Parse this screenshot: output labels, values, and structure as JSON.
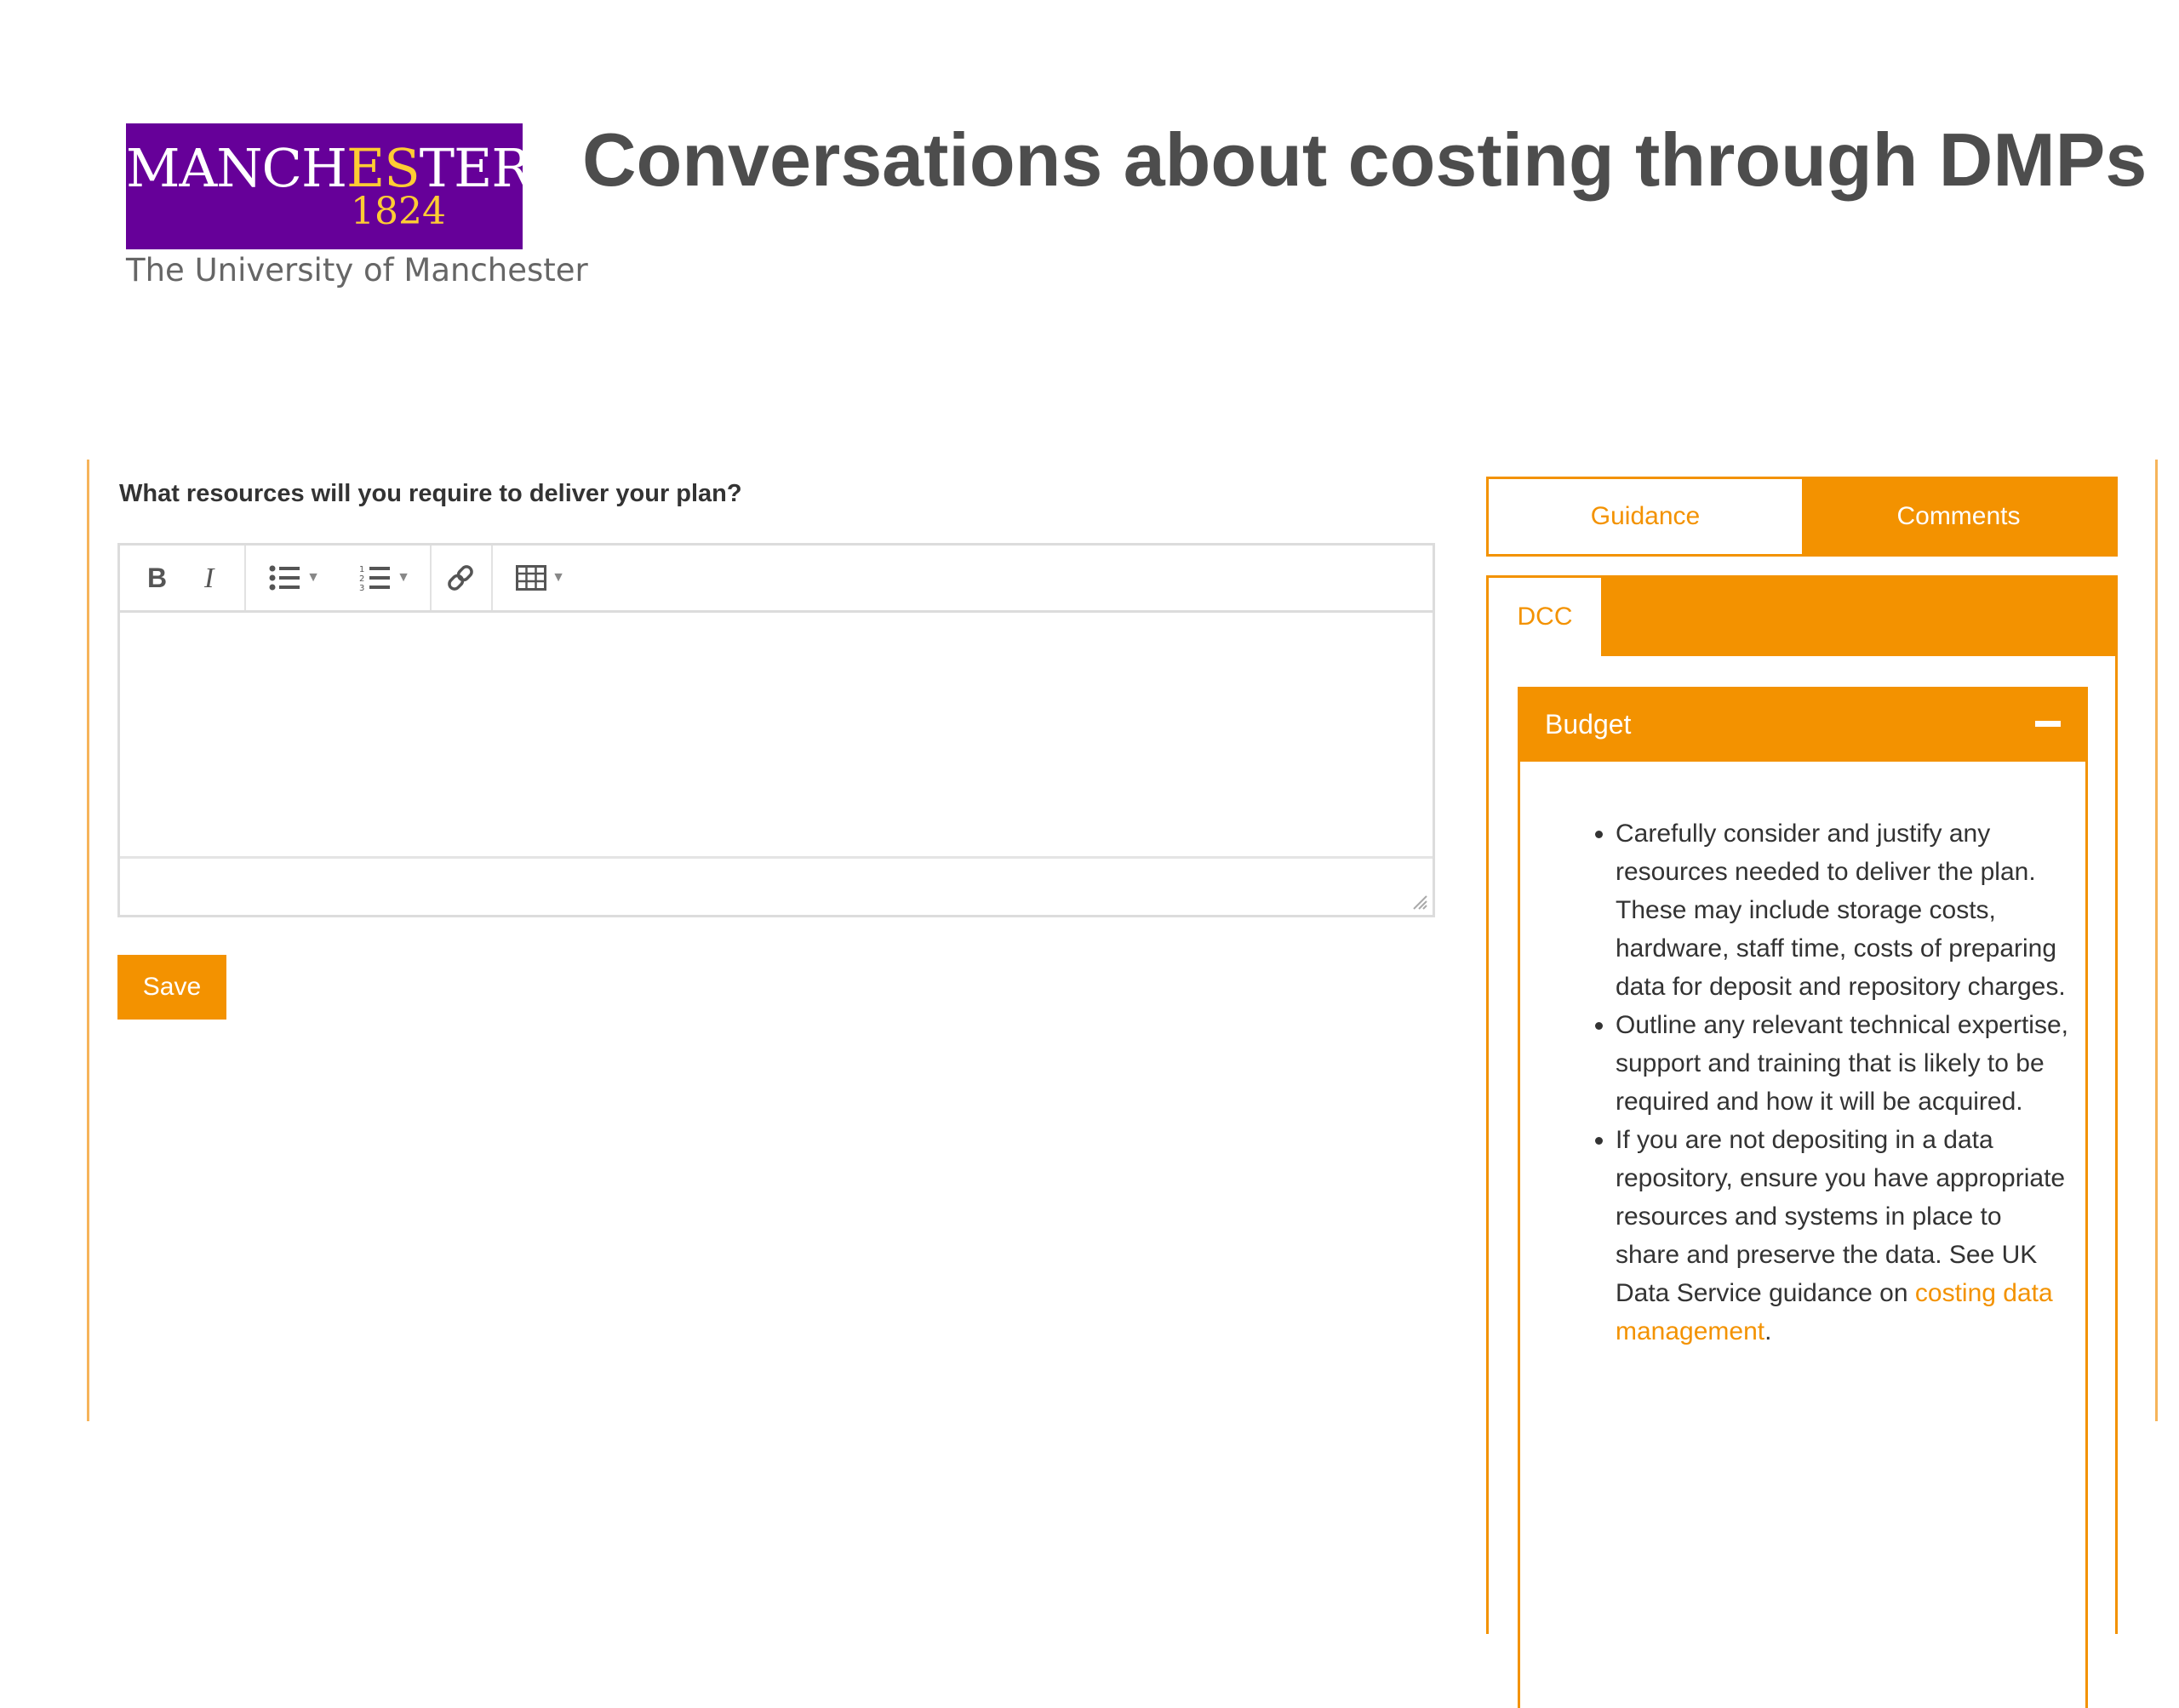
{
  "logo": {
    "word_part1": "MANCH",
    "word_part2": "ES",
    "word_part3": "T",
    "word_part4": "ER",
    "year": "1824",
    "subtitle": "The University of Manchester",
    "colors": {
      "background": "#660099",
      "accent": "#ffcc33"
    }
  },
  "slide_title": "Conversations about costing through DMPs",
  "question": "What resources will you require to deliver your plan?",
  "editor": {
    "toolbar": [
      {
        "name": "bold-icon"
      },
      {
        "name": "italic-icon"
      },
      {
        "name": "bullet-list-icon"
      },
      {
        "name": "numbered-list-icon"
      },
      {
        "name": "link-icon"
      },
      {
        "name": "table-icon"
      }
    ],
    "value": ""
  },
  "save_label": "Save",
  "tabs": {
    "guidance": "Guidance",
    "comments": "Comments"
  },
  "guidance": {
    "source_tab": "DCC",
    "section_title": "Budget",
    "bullets": [
      "Carefully consider and justify any resources needed to deliver the plan. These may include storage costs, hardware, staff time, costs of preparing data for deposit and repository charges.",
      "Outline any relevant technical expertise, support and training that is likely to be required and how it will be acquired."
    ],
    "bullet3_prefix": "If you are not depositing in a data repository, ensure you have appropriate resources and systems in place to share and preserve the data. See UK Data Service guidance on ",
    "bullet3_link": "costing data management",
    "bullet3_suffix": "."
  },
  "colors": {
    "accent": "#f39200",
    "text": "#333333",
    "title": "#4d4d4d"
  }
}
